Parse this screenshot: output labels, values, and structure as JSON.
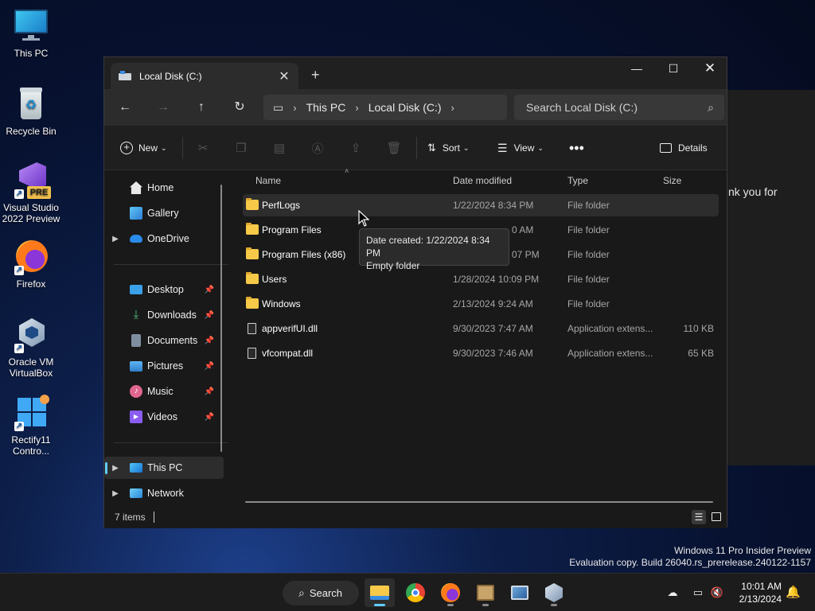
{
  "desktop": {
    "icons": [
      {
        "label": "This PC"
      },
      {
        "label": "Recycle Bin"
      },
      {
        "label": "Visual Studio 2022 Preview"
      },
      {
        "label": "Firefox"
      },
      {
        "label": "Oracle VM VirtualBox"
      },
      {
        "label": "Rectify11 Contro..."
      }
    ],
    "vs_badge": "PRE"
  },
  "background_window": {
    "text": "nk you for"
  },
  "explorer": {
    "tab_title": "Local Disk (C:)",
    "breadcrumb": [
      "This PC",
      "Local Disk (C:)"
    ],
    "search_placeholder": "Search Local Disk (C:)",
    "toolbar": {
      "new_label": "New",
      "sort_label": "Sort",
      "view_label": "View",
      "details_label": "Details"
    },
    "nav": {
      "home": "Home",
      "gallery": "Gallery",
      "onedrive": "OneDrive",
      "desktop": "Desktop",
      "downloads": "Downloads",
      "documents": "Documents",
      "pictures": "Pictures",
      "music": "Music",
      "videos": "Videos",
      "this_pc": "This PC",
      "network": "Network"
    },
    "columns": {
      "name": "Name",
      "date": "Date modified",
      "type": "Type",
      "size": "Size"
    },
    "files": [
      {
        "name": "PerfLogs",
        "date": "1/22/2024 8:34 PM",
        "type": "File folder",
        "size": ""
      },
      {
        "name": "Program Files",
        "date": "0 AM",
        "type": "File folder",
        "size": ""
      },
      {
        "name": "Program Files (x86)",
        "date": "07 PM",
        "type": "File folder",
        "size": ""
      },
      {
        "name": "Users",
        "date": "1/28/2024 10:09 PM",
        "type": "File folder",
        "size": ""
      },
      {
        "name": "Windows",
        "date": "2/13/2024 9:24 AM",
        "type": "File folder",
        "size": ""
      },
      {
        "name": "appverifUI.dll",
        "date": "9/30/2023 7:47 AM",
        "type": "Application extens...",
        "size": "110 KB"
      },
      {
        "name": "vfcompat.dll",
        "date": "9/30/2023 7:46 AM",
        "type": "Application extens...",
        "size": "65 KB"
      }
    ],
    "tooltip": {
      "line1": "Date created: 1/22/2024 8:34 PM",
      "line2": "Empty folder"
    },
    "status": "7 items"
  },
  "watermark": {
    "line1": "Windows 11 Pro Insider Preview",
    "line2": "Evaluation copy. Build 26040.rs_prerelease.240122-1157"
  },
  "taskbar": {
    "search_label": "Search",
    "time": "10:01 AM",
    "date": "2/13/2024"
  },
  "colors": {
    "accent": "#60cdff",
    "folder": "#f7c948"
  }
}
